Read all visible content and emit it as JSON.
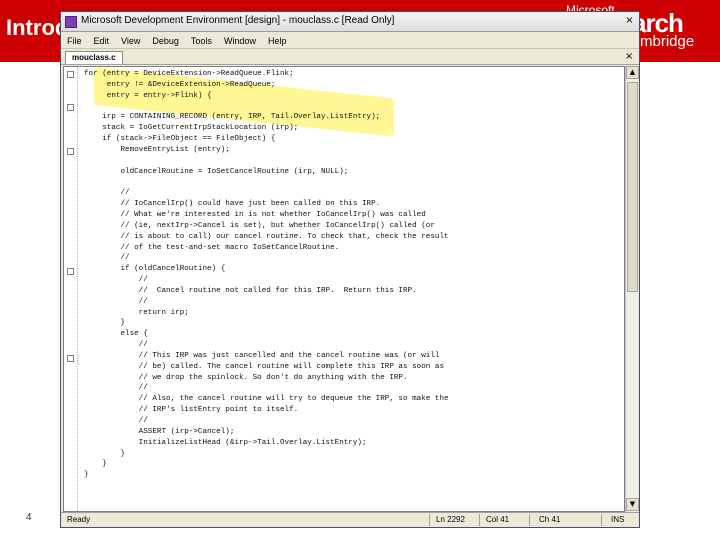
{
  "slide": {
    "title": "Introd",
    "logo_small": "Microsoft",
    "logo_big": "arch",
    "logo_sub": "mbridge",
    "page_number": "4"
  },
  "window": {
    "title": "Microsoft Development Environment [design] - mouclass.c [Read Only]",
    "close_glyph": "×",
    "menu": [
      "File",
      "Edit",
      "View",
      "Debug",
      "Tools",
      "Window",
      "Help"
    ],
    "file_tab": "mouclass.c",
    "tab_close_glyph": "×"
  },
  "code_lines": [
    "for (entry = DeviceExtension->ReadQueue.Flink;",
    "     entry != &DeviceExtension->ReadQueue;",
    "     entry = entry->Flink) {",
    "",
    "    irp = CONTAINING_RECORD (entry, IRP, Tail.Overlay.ListEntry);",
    "    stack = IoGetCurrentIrpStackLocation (irp);",
    "    if (stack->FileObject == FileObject) {",
    "        RemoveEntryList (entry);",
    "",
    "        oldCancelRoutine = IoSetCancelRoutine (irp, NULL);",
    "",
    "        //",
    "        // IoCancelIrp() could have just been called on this IRP.",
    "        // What we're interested in is not whether IoCancelIrp() was called",
    "        // (ie, nextIrp->Cancel is set), but whether IoCancelIrp() called (or",
    "        // is about to call) our cancel routine. To check that, check the result",
    "        // of the test-and-set macro IoSetCancelRoutine.",
    "        //",
    "        if (oldCancelRoutine) {",
    "            //",
    "            //  Cancel routine not called for this IRP.  Return this IRP.",
    "            //",
    "            return irp;",
    "        }",
    "        else {",
    "            //",
    "            // This IRP was just cancelled and the cancel routine was (or will",
    "            // be) called. The cancel routine will complete this IRP as soon as",
    "            // we drop the spinlock. So don't do anything with the IRP.",
    "            //",
    "            // Also, the cancel routine will try to dequeue the IRP, so make the",
    "            // IRP's listEntry point to itself.",
    "            //",
    "            ASSERT (irp->Cancel);",
    "            InitializeListHead (&irp->Tail.Overlay.ListEntry);",
    "        }",
    "    }",
    "}"
  ],
  "status": {
    "ready": "Ready",
    "line": "Ln 2292",
    "col": "Col 41",
    "ch": "Ch 41",
    "ins": "INS"
  },
  "scrollbar": {
    "up_glyph": "▲",
    "down_glyph": "▼"
  },
  "colors": {
    "slide_red": "#cc0000",
    "highlight": "#fff03c"
  }
}
